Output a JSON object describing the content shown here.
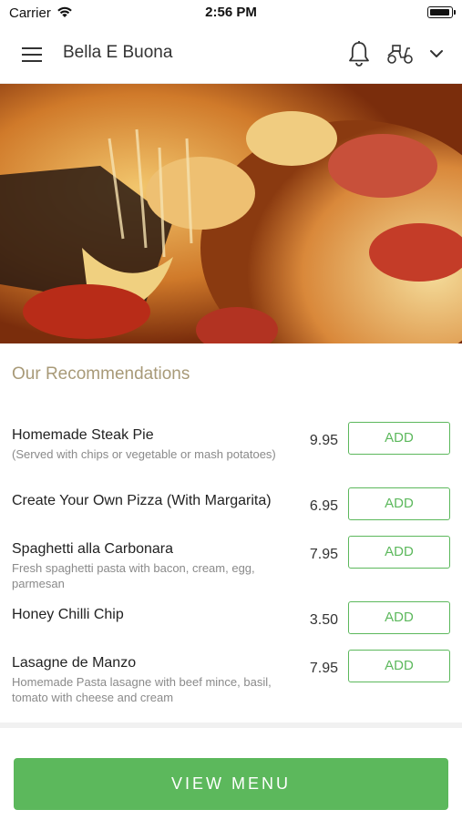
{
  "status_bar": {
    "carrier": "Carrier",
    "time": "2:56 PM"
  },
  "header": {
    "title": "Bella E Buona",
    "icons": [
      "hamburger-menu-icon",
      "bell-icon",
      "scooter-icon",
      "chevron-down-icon"
    ]
  },
  "hero": {
    "image_description_icon": "pizza-photo"
  },
  "recommendations": {
    "title": "Our Recommendations",
    "items": [
      {
        "name": "Homemade Steak Pie",
        "description": "(Served with chips or vegetable or mash potatoes)",
        "price": "9.95",
        "add_label": "ADD"
      },
      {
        "name": "Create Your Own Pizza (With Margarita)",
        "description": "",
        "price": "6.95",
        "add_label": "ADD"
      },
      {
        "name": "Spaghetti alla Carbonara",
        "description": "Fresh spaghetti pasta with bacon, cream, egg, parmesan",
        "price": "7.95",
        "add_label": "ADD"
      },
      {
        "name": "Honey Chilli Chip",
        "description": "",
        "price": "3.50",
        "add_label": "ADD"
      },
      {
        "name": "Lasagne de Manzo",
        "description": "Homemade Pasta lasagne with beef mince, basil, tomato with cheese and cream",
        "price": "7.95",
        "add_label": "ADD"
      }
    ]
  },
  "footer": {
    "view_menu_label": "VIEW MENU"
  },
  "colors": {
    "accent_green": "#5cb85c",
    "section_title": "#a89a78"
  }
}
